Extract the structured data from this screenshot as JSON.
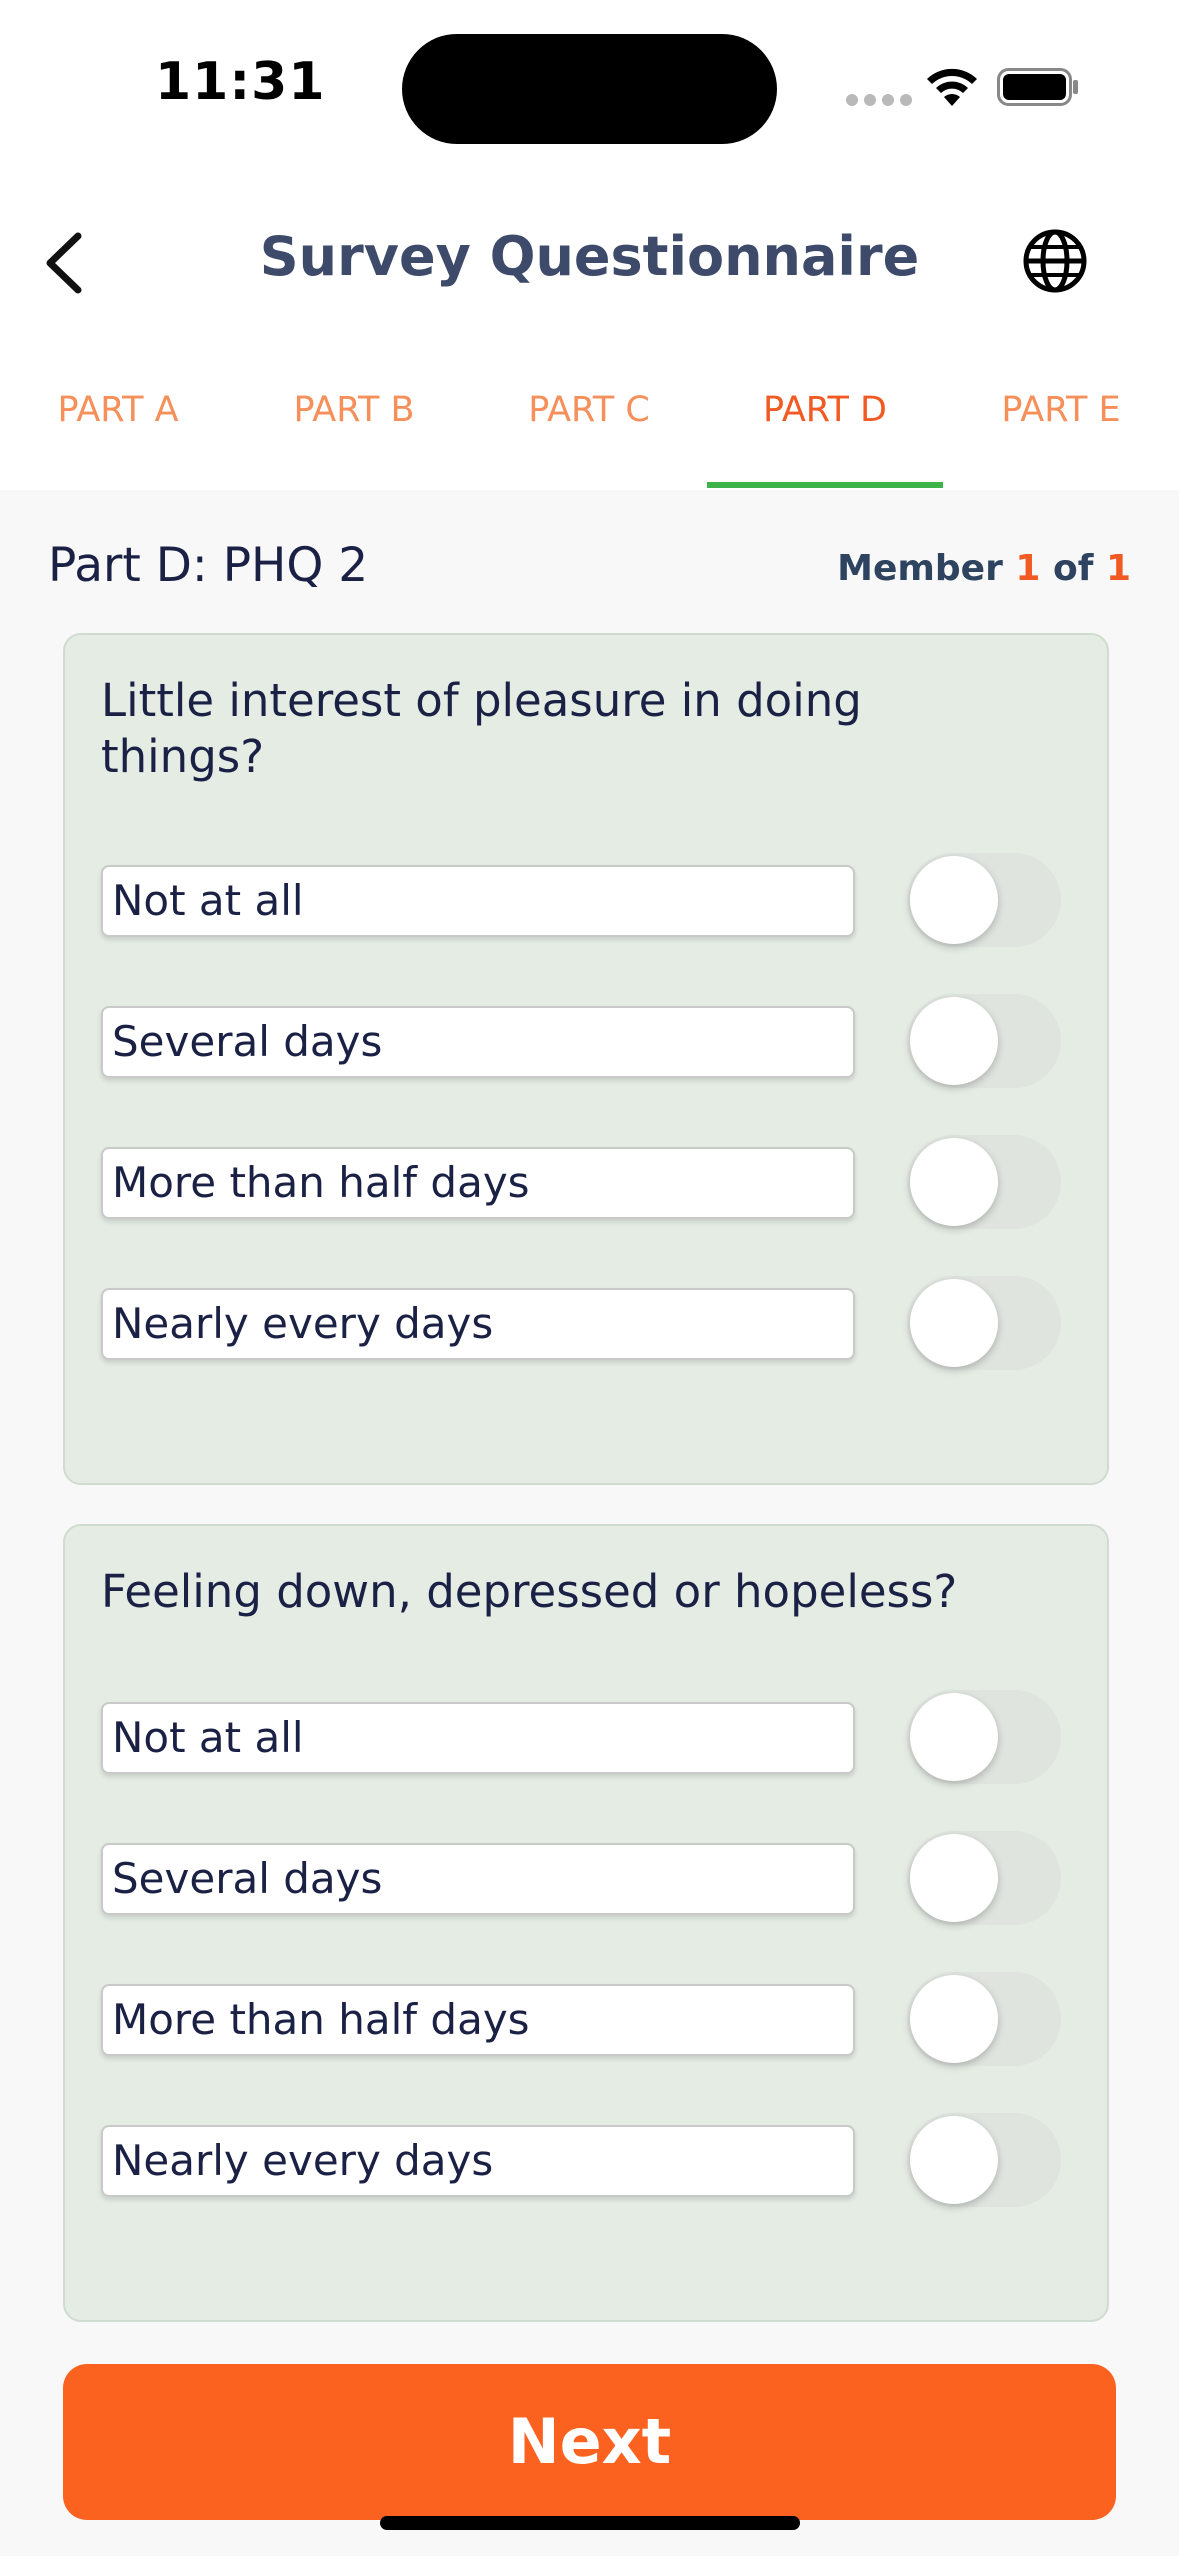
{
  "status_bar": {
    "time": "11:31"
  },
  "header": {
    "title": "Survey Questionnaire"
  },
  "tabs": [
    {
      "label": "PART A",
      "active": false
    },
    {
      "label": "PART B",
      "active": false
    },
    {
      "label": "PART C",
      "active": false
    },
    {
      "label": "PART D",
      "active": true
    },
    {
      "label": "PART E",
      "active": false
    }
  ],
  "section": {
    "title": "Part D: PHQ 2",
    "member_label": "Member",
    "member_current": "1",
    "member_of": "of",
    "member_total": "1"
  },
  "questions": [
    {
      "text": "Little interest of pleasure in doing things?",
      "options": [
        {
          "label": "Not at all",
          "selected": false
        },
        {
          "label": "Several days",
          "selected": false
        },
        {
          "label": "More than half days",
          "selected": false
        },
        {
          "label": "Nearly every days",
          "selected": false
        }
      ]
    },
    {
      "text": "Feeling down, depressed or hopeless?",
      "options": [
        {
          "label": "Not at all",
          "selected": false
        },
        {
          "label": "Several days",
          "selected": false
        },
        {
          "label": "More than half days",
          "selected": false
        },
        {
          "label": "Nearly every days",
          "selected": false
        }
      ]
    }
  ],
  "footer": {
    "next_label": "Next"
  },
  "colors": {
    "accent": "#fb6220",
    "tab_text": "#f5905b",
    "tab_active": "#f15a22",
    "tab_underline": "#3cb44a",
    "card_bg": "#e4ece4",
    "title": "#3e4a6a"
  },
  "icons": {
    "back": "chevron-left-icon",
    "language": "globe-icon",
    "wifi": "wifi-icon",
    "battery": "battery-icon"
  }
}
